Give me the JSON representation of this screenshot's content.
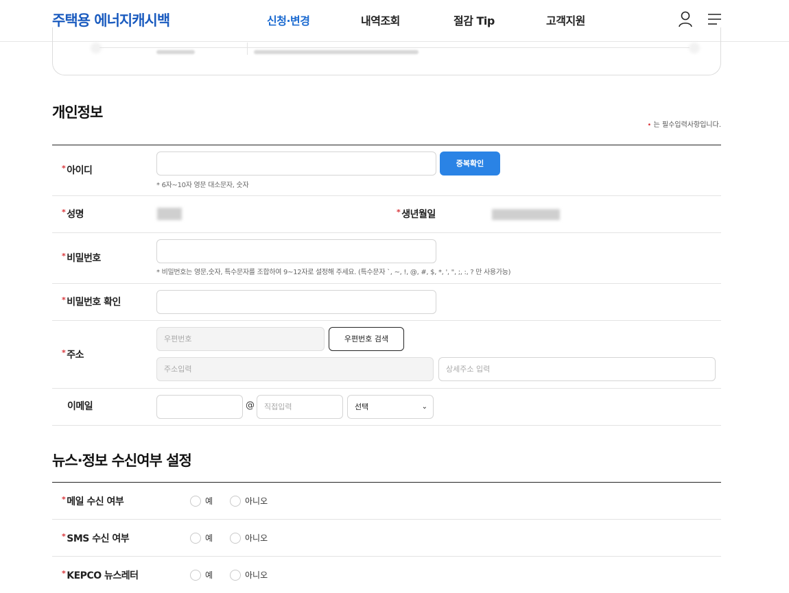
{
  "header": {
    "logo": "주택용 에너지캐시백",
    "nav": [
      "신청·변경",
      "내역조회",
      "절감 Tip",
      "고객지원"
    ]
  },
  "personal": {
    "title": "개인정보",
    "required_note": "는 필수입력사항입니다.",
    "id_label": "아이디",
    "id_check_button": "중복확인",
    "id_help": "* 6자~10자 영문 대소문자, 숫자",
    "name_label": "성명",
    "birth_label": "생년월일",
    "pw_label": "비밀번호",
    "pw_help": "* 비밀번호는 영문,숫자, 특수문자를 조합하여 9~12자로 설정해 주세요. (특수문자 `, ~, !, @, #, $, *, ', \", ;, :, ? 만 사용가능)",
    "pw_confirm_label": "비밀번호 확인",
    "address_label": "주소",
    "zip_placeholder": "우편번호",
    "zip_search_button": "우편번호 검색",
    "address_placeholder": "주소입력",
    "address_detail_placeholder": "상세주소 입력",
    "email_label": "이메일",
    "email_at": "@",
    "email_domain_placeholder": "직접입력",
    "email_select_value": "선택"
  },
  "news": {
    "title": "뉴스·정보 수신여부 설정",
    "rows": [
      {
        "label": "메일 수신 여부",
        "yes": "예",
        "no": "아니오"
      },
      {
        "label": "SMS 수신 여부",
        "yes": "예",
        "no": "아니오"
      },
      {
        "label": "KEPCO 뉴스레터",
        "yes": "예",
        "no": "아니오"
      }
    ]
  },
  "colors": {
    "brand": "#1a5bbf",
    "accent": "#2a83e5",
    "required": "#d8353a"
  }
}
